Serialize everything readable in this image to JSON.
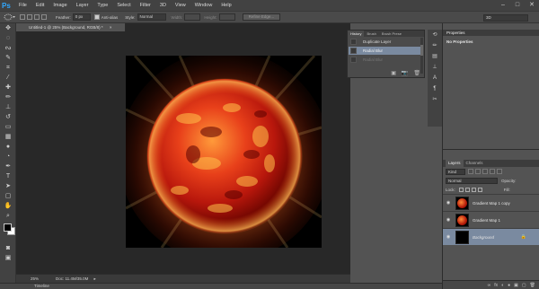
{
  "app": {
    "logo": "Ps",
    "menu": [
      "File",
      "Edit",
      "Image",
      "Layer",
      "Type",
      "Select",
      "Filter",
      "3D",
      "View",
      "Window",
      "Help"
    ],
    "window_controls": [
      "–",
      "□",
      "✕"
    ]
  },
  "options": {
    "feather_label": "Feather:",
    "feather_value": "0 px",
    "antialias_label": "Anti-alias",
    "style_label": "Style:",
    "style_value": "Normal",
    "width_label": "Width:",
    "height_label": "Height:",
    "refine_edge": "Refine Edge...",
    "workspace": "3D"
  },
  "document": {
    "tab_title": "Untitled-1 @ 25% (Background, RGB/8) *",
    "tab_close": "×",
    "zoom": "25%",
    "doc_info": "Doc: 11.4M/35.0M",
    "status_arrow": "▸",
    "timeline": "Timeline"
  },
  "history": {
    "tabs": [
      "History",
      "Brush",
      "Brush Prese"
    ],
    "items": [
      {
        "label": "Duplicate Layer",
        "state": "normal"
      },
      {
        "label": "Radial Blur",
        "state": "selected"
      },
      {
        "label": "Radial Blur",
        "state": "dim"
      }
    ],
    "footer_icons": [
      "▣",
      "📷",
      "🗑"
    ]
  },
  "properties": {
    "header": "Properties",
    "title": "No Properties"
  },
  "layers": {
    "tabs": [
      "Layers",
      "Channels"
    ],
    "kind_label": "Kind",
    "blend_mode": "Normal",
    "opacity_label": "Opacity:",
    "lock_label": "Lock:",
    "fill_label": "Fill:",
    "items": [
      {
        "name": "Gradient Map 1 copy",
        "type": "planet",
        "selected": false
      },
      {
        "name": "Gradient Map 1",
        "type": "planet",
        "selected": false
      },
      {
        "name": "Background",
        "type": "black",
        "selected": true,
        "locked": true
      }
    ],
    "footer_icons": [
      "∞",
      "fx",
      "◐",
      "●",
      "▣",
      "▢",
      "🗑"
    ]
  },
  "colors": {
    "accent": "#31a8ff",
    "selection": "#7a8aa0",
    "panel_bg": "#535353",
    "canvas_bg": "#000000",
    "sphere_bright": "#ff7a2a",
    "sphere_dark": "#5a0000"
  }
}
